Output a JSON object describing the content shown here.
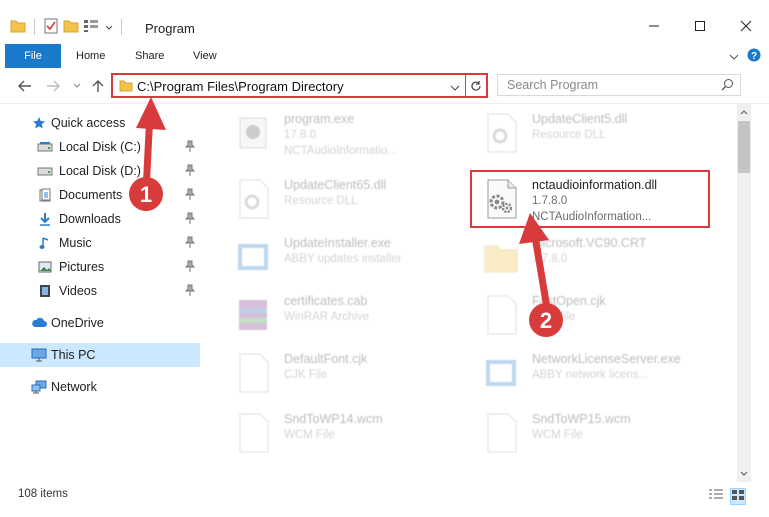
{
  "window": {
    "title": "Program"
  },
  "ribbon": {
    "tabs": [
      "File",
      "Home",
      "Share",
      "View"
    ]
  },
  "address": {
    "path": "C:\\Program Files\\Program Directory"
  },
  "search": {
    "placeholder": "Search Program"
  },
  "sidebar": {
    "items": [
      {
        "label": "Quick access",
        "icon": "star-icon"
      },
      {
        "label": "Local Disk (C:)",
        "icon": "drive-icon",
        "pinned": true
      },
      {
        "label": "Local Disk (D:)",
        "icon": "drive-icon",
        "pinned": true
      },
      {
        "label": "Documents",
        "icon": "documents-icon",
        "pinned": true
      },
      {
        "label": "Downloads",
        "icon": "download-icon",
        "pinned": true
      },
      {
        "label": "Music",
        "icon": "music-icon",
        "pinned": true
      },
      {
        "label": "Pictures",
        "icon": "pictures-icon",
        "pinned": true
      },
      {
        "label": "Videos",
        "icon": "videos-icon",
        "pinned": true
      },
      {
        "label": "OneDrive",
        "icon": "cloud-icon"
      },
      {
        "label": "This PC",
        "icon": "pc-icon",
        "selected": true
      },
      {
        "label": "Network",
        "icon": "network-icon"
      }
    ]
  },
  "files": [
    {
      "name": "program.exe",
      "line1": "17.8.0",
      "line2": "NCTAudioInformatio...",
      "icon": "exe-icon"
    },
    {
      "name": "UpdateClient5.dll",
      "line1": "Resource DLL",
      "line2": "",
      "icon": "dll-icon"
    },
    {
      "name": "UpdateClient65.dll",
      "line1": "Resource DLL",
      "line2": "",
      "icon": "dll-icon"
    },
    {
      "name": "nctaudioinformation.dll",
      "line1": "1.7.8.0",
      "line2": "NCTAudioInformation...",
      "icon": "dll-gear-icon"
    },
    {
      "name": "UpdateInstaller.exe",
      "line1": "ABBY updates installer",
      "line2": "",
      "icon": "installer-icon"
    },
    {
      "name": "Microsoft.VC90.CRT",
      "line1": "1.7.8.0",
      "line2": "",
      "icon": "folder-icon"
    },
    {
      "name": "certificates.cab",
      "line1": "WinRAR Archive",
      "line2": "",
      "icon": "archive-icon"
    },
    {
      "name": "FastOpen.cjk",
      "line1": "CJK File",
      "line2": "",
      "icon": "file-icon"
    },
    {
      "name": "DefaultFont.cjk",
      "line1": "CJK File",
      "line2": "",
      "icon": "file-icon"
    },
    {
      "name": "NetworkLicenseServer.exe",
      "line1": "ABBY network licens...",
      "line2": "",
      "icon": "installer-icon"
    },
    {
      "name": "SndToWP14.wcm",
      "line1": "WCM File",
      "line2": "",
      "icon": "file-icon"
    },
    {
      "name": "SndToWP15.wcm",
      "line1": "WCM File",
      "line2": "",
      "icon": "file-icon"
    }
  ],
  "status": {
    "count": "108 items"
  },
  "annotations": {
    "badge1": "1",
    "badge2": "2"
  },
  "colors": {
    "accent": "#1979ca",
    "highlight": "#d83b3b",
    "selection": "#cce8ff"
  }
}
